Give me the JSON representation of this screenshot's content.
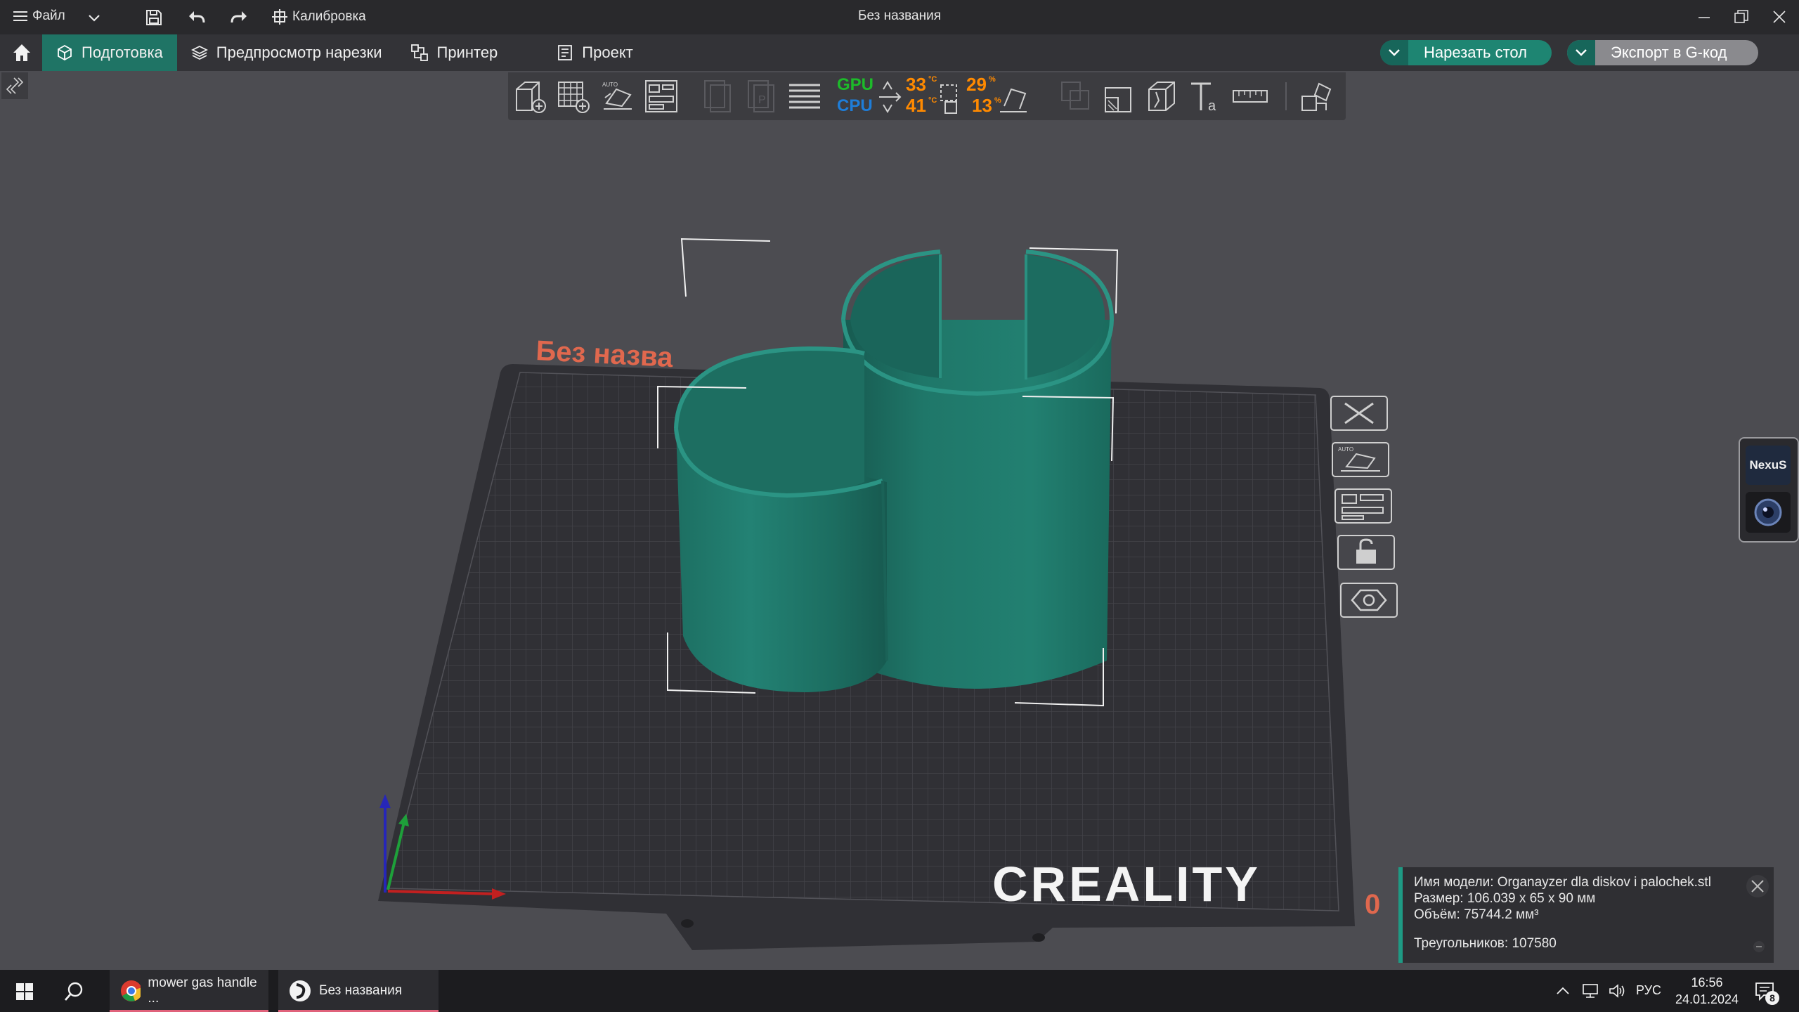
{
  "titlebar": {
    "file_label": "Файл",
    "calibration_label": "Калибровка",
    "window_title": "Без названия"
  },
  "tabs": [
    {
      "label": "Подготовка",
      "active": true
    },
    {
      "label": "Предпросмотр нарезки",
      "active": false
    },
    {
      "label": "Принтер",
      "active": false
    },
    {
      "label": "Проект",
      "active": false
    }
  ],
  "actions": {
    "slice_label": "Нарезать стол",
    "export_label": "Экспорт в G-код"
  },
  "monitor": {
    "gpu_label": "GPU",
    "cpu_label": "CPU",
    "gpu_temp": "33",
    "cpu_temp": "41",
    "unit_c": "°C",
    "gpu_load": "29",
    "cpu_load": "13",
    "unit_pct": "%"
  },
  "plate": {
    "plate_name": "Без назва",
    "brand": "CREALITY",
    "plate_index": "0"
  },
  "widget": {
    "logo_text": "NexuS"
  },
  "model_info": {
    "name_line": "Имя модели: Organayzer dla diskov i palochek.stl",
    "size_line": "Размер: 106.039 x 65 x 90 мм",
    "volume_line": "Объём: 75744.2 мм³",
    "triangles_line": "Треугольников: 107580"
  },
  "taskbar": {
    "task1_label": "mower gas handle ...",
    "task2_label": "Без названия",
    "lang": "РУС",
    "time": "16:56",
    "date": "24.01.2024",
    "notif_count": "8"
  },
  "colors": {
    "accent": "#1f7465",
    "model": "#1f7a6b",
    "plate": "#333338",
    "background": "#4c4c51"
  }
}
